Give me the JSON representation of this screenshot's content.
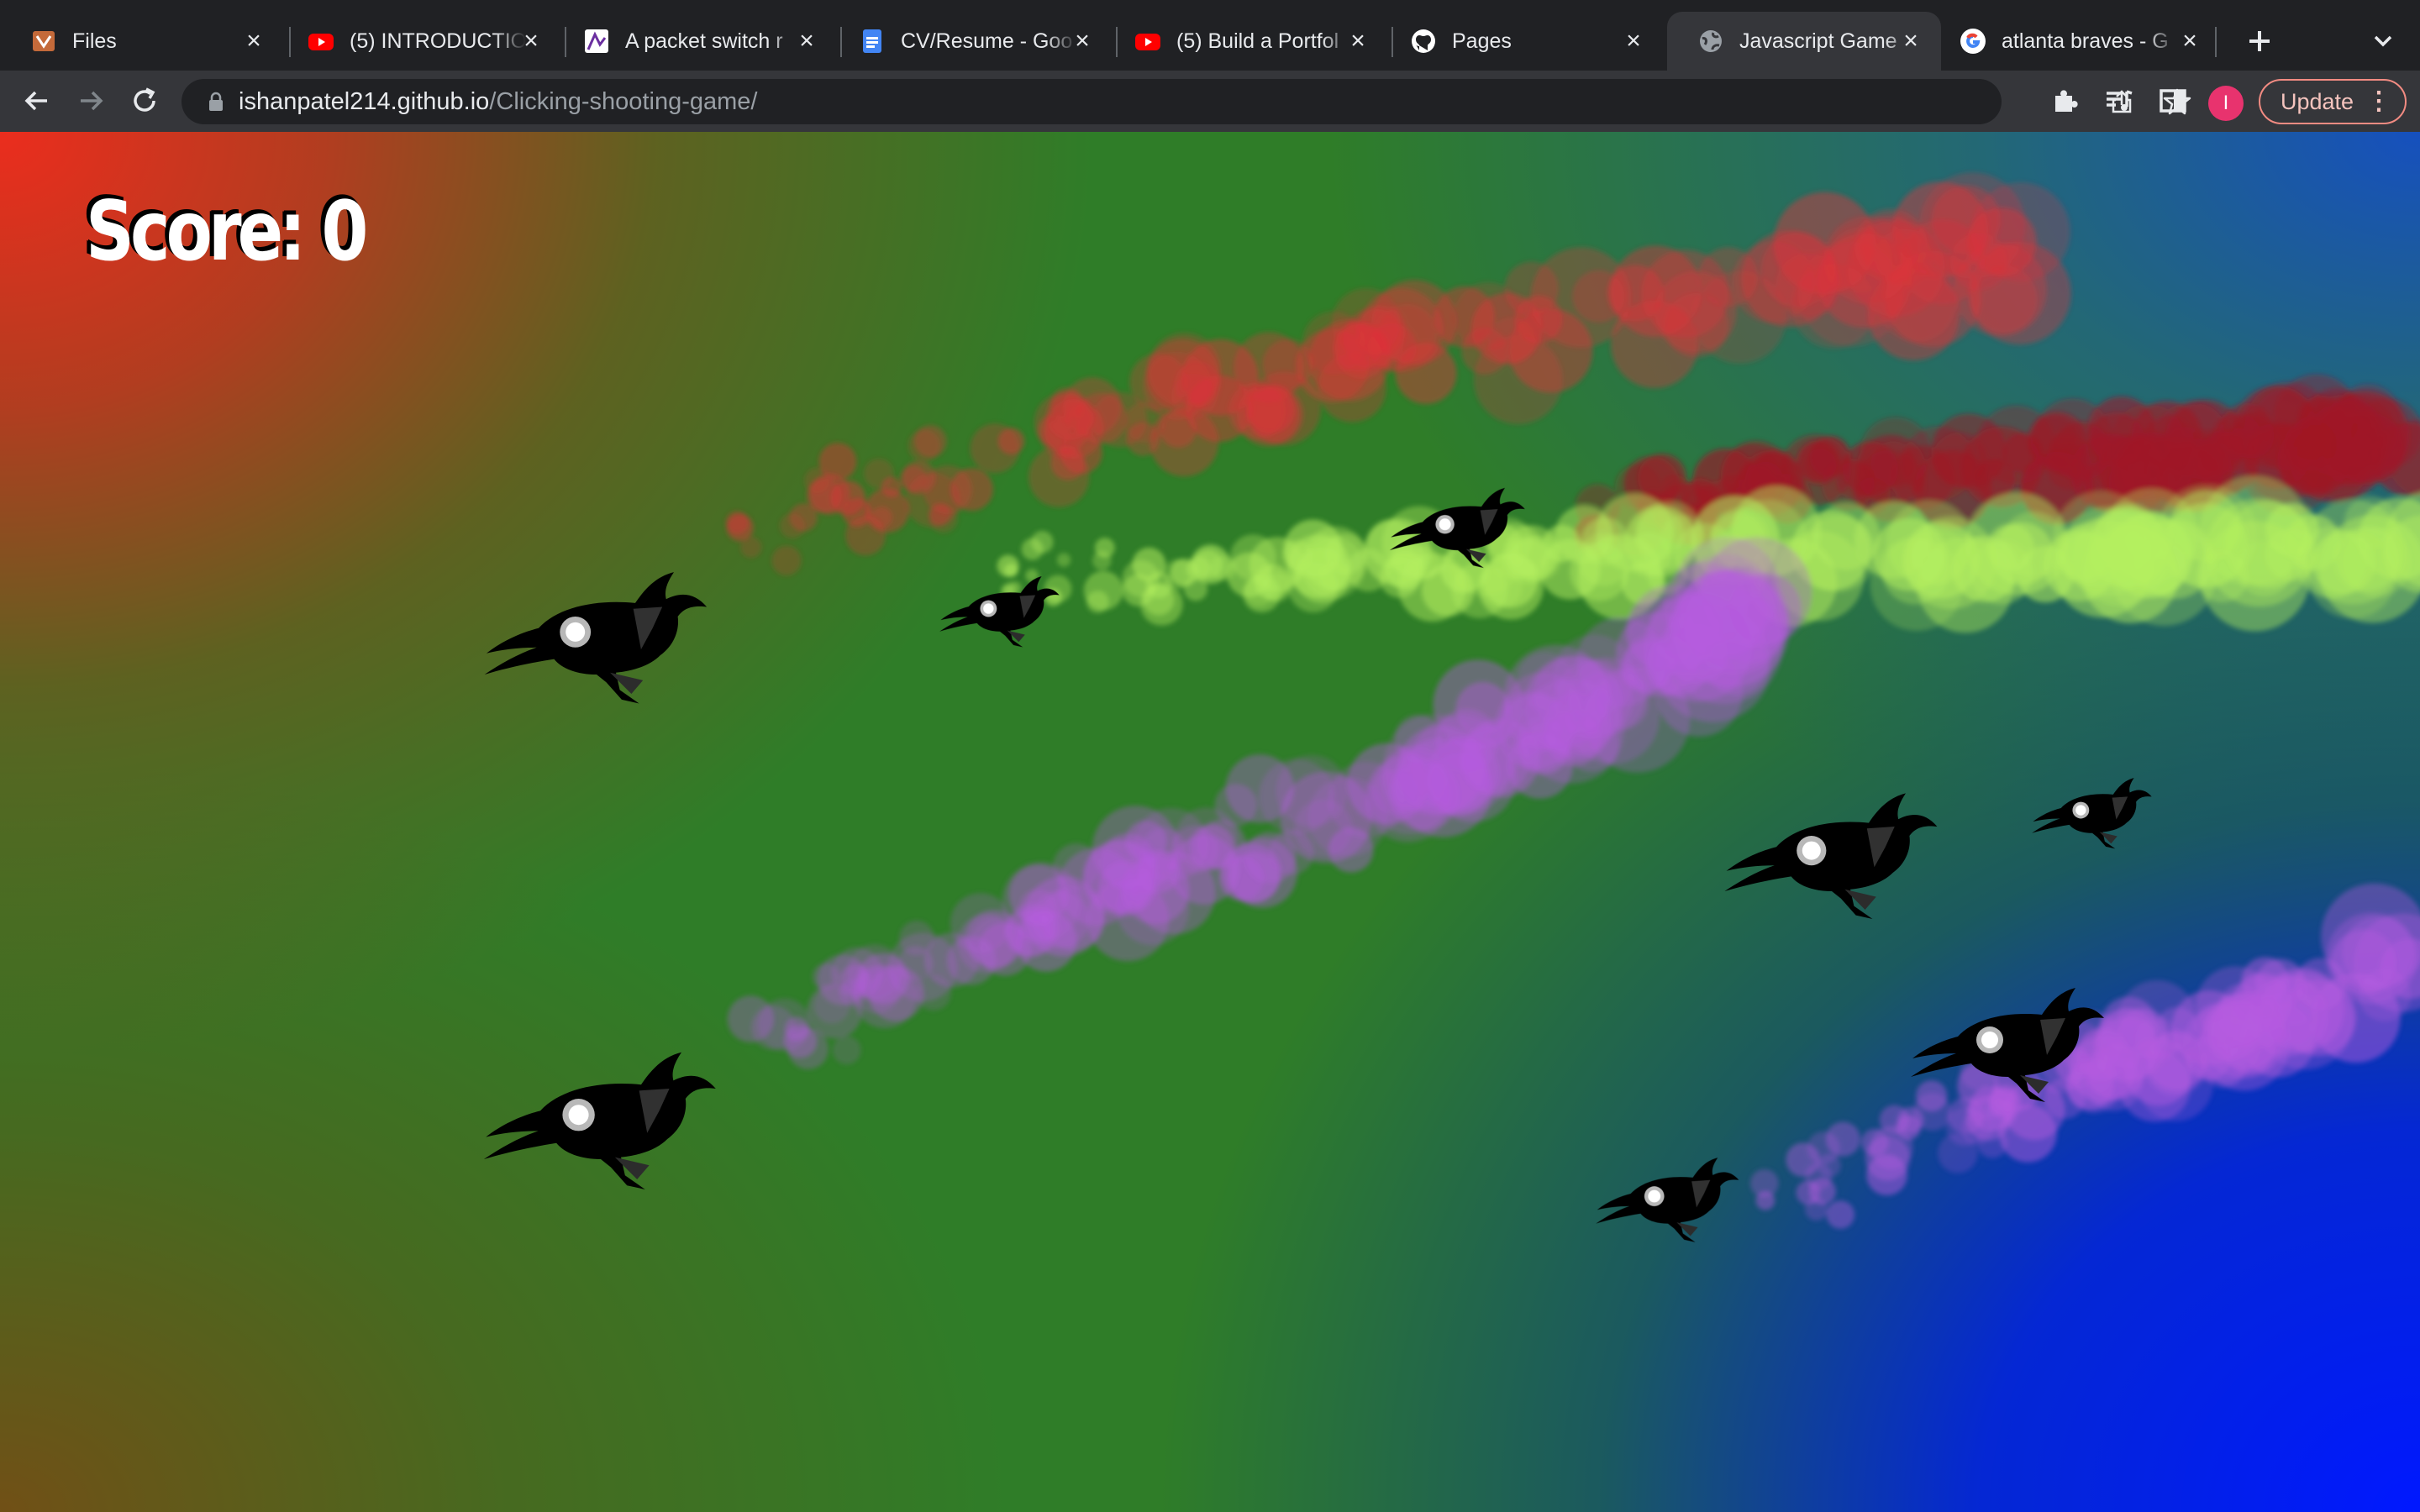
{
  "browser": {
    "tabs": [
      {
        "title": "Files",
        "icon": "files-favicon",
        "active": false
      },
      {
        "title": "(5) INTRODUCTIO",
        "icon": "youtube-favicon",
        "active": false
      },
      {
        "title": "A packet switch r",
        "icon": "site-favicon",
        "active": false
      },
      {
        "title": "CV/Resume - Goo",
        "icon": "google-docs-favicon",
        "active": false
      },
      {
        "title": "(5) Build a Portfol",
        "icon": "youtube-favicon",
        "active": false
      },
      {
        "title": "Pages",
        "icon": "github-favicon",
        "active": false
      },
      {
        "title": "Javascript Game",
        "icon": "globe-favicon",
        "active": true
      },
      {
        "title": "atlanta braves - G",
        "icon": "google-favicon",
        "active": false
      }
    ],
    "address": {
      "host": "ishanpatel214.github.io",
      "path": "/Clicking-shooting-game/"
    },
    "profile_initial": "I",
    "update_label": "Update",
    "colors": {
      "tabstrip": "#202124",
      "toolbar": "#35363a",
      "profile": "#e8336e",
      "update_border": "#f28b82"
    }
  },
  "game": {
    "score_label": "Score: 0",
    "score": 0,
    "trail_colors": {
      "red": "#e0333a",
      "dark_red": "#a01826",
      "lime": "#b5f060",
      "purple": "#b65ce0"
    }
  }
}
